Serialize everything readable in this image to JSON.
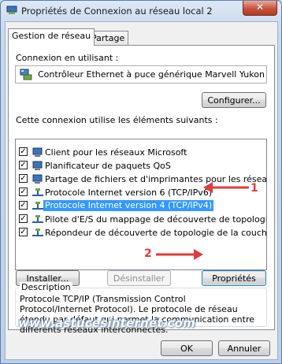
{
  "window": {
    "title": "Propriétés de Connexion au réseau local 2",
    "close_glyph": "✕"
  },
  "tabs": [
    {
      "label": "Gestion de réseau",
      "active": true
    },
    {
      "label": "Partage",
      "active": false
    }
  ],
  "connection": {
    "label": "Connexion en utilisant :",
    "adapter": "Contrôleur Ethernet à puce générique Marvell Yukon",
    "configure_button": "Configurer..."
  },
  "items": {
    "label": "Cette connexion utilise les éléments suivants :",
    "list": [
      {
        "label": "Client pour les réseaux Microsoft",
        "checked": true,
        "icon": "network-client-icon"
      },
      {
        "label": "Planificateur de paquets QoS",
        "checked": true,
        "icon": "network-service-icon"
      },
      {
        "label": "Partage de fichiers et d'imprimantes pour les réseaux Mi...",
        "checked": true,
        "icon": "network-service-icon"
      },
      {
        "label": "Protocole Internet version 6 (TCP/IPv6)",
        "checked": true,
        "icon": "protocol-icon"
      },
      {
        "label": "Protocole Internet version 4 (TCP/IPv4)",
        "checked": true,
        "icon": "protocol-icon",
        "selected": true
      },
      {
        "label": "Pilote d'E/S du mappage de découverte de topologie d...",
        "checked": true,
        "icon": "protocol-icon"
      },
      {
        "label": "Répondeur de découverte de topologie de la couche d...",
        "checked": true,
        "icon": "protocol-icon"
      }
    ]
  },
  "buttons": {
    "install": "Installer...",
    "uninstall": "Désinstaller",
    "properties": "Propriétés",
    "ok": "OK",
    "cancel": "Annuler"
  },
  "description": {
    "title": "Description",
    "text": "Protocole TCP/IP (Transmission Control Protocol/Internet Protocol). Le protocole de réseau étendu par défaut qui permet la communication entre différents réseaux interconnectés."
  },
  "annotations": {
    "step1": "1",
    "step2": "2",
    "color": "#e23a3a"
  },
  "watermark": "www.astucesinternet.com",
  "colors": {
    "selection": "#3399ff",
    "titlebar": "#c7d9ee",
    "close": "#c8533c"
  }
}
